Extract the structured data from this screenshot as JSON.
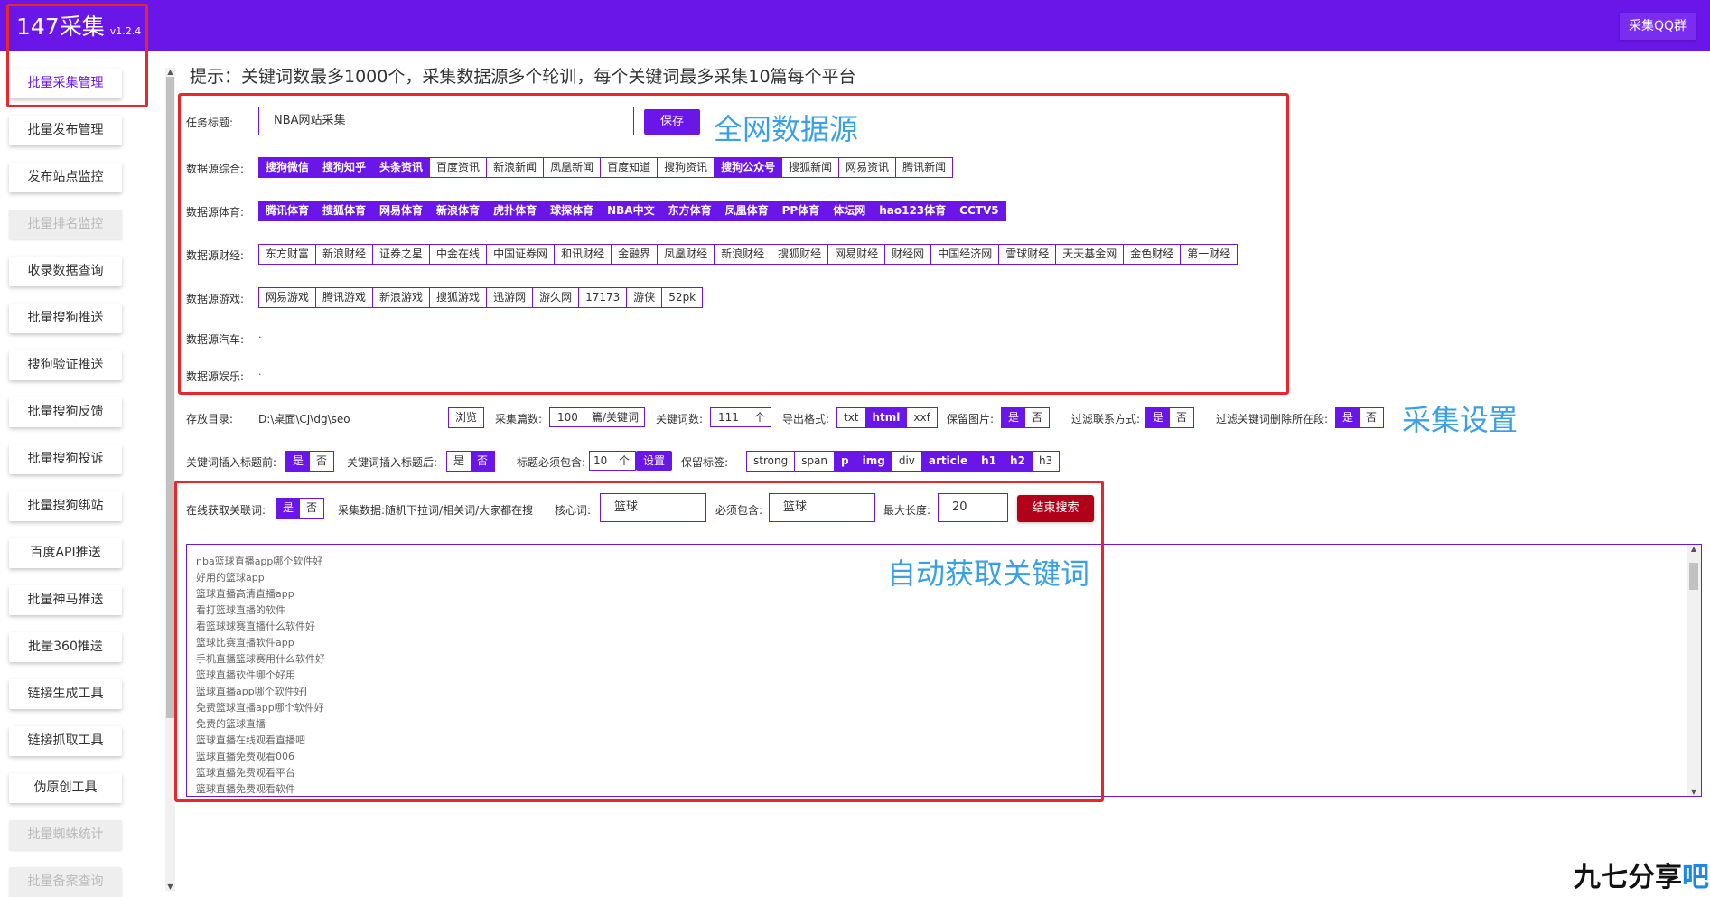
{
  "header": {
    "app_name": "147采集",
    "version": "v1.2.4",
    "qq_button": "采集QQ群"
  },
  "sidebar": {
    "items": [
      {
        "label": "批量采集管理",
        "state": "active"
      },
      {
        "label": "批量发布管理",
        "state": "normal"
      },
      {
        "label": "发布站点监控",
        "state": "normal"
      },
      {
        "label": "批量排名监控",
        "state": "disabled"
      },
      {
        "label": "收录数据查询",
        "state": "normal"
      },
      {
        "label": "批量搜狗推送",
        "state": "normal"
      },
      {
        "label": "搜狗验证推送",
        "state": "normal"
      },
      {
        "label": "批量搜狗反馈",
        "state": "normal"
      },
      {
        "label": "批量搜狗投诉",
        "state": "normal"
      },
      {
        "label": "批量搜狗绑站",
        "state": "normal"
      },
      {
        "label": "百度API推送",
        "state": "normal"
      },
      {
        "label": "批量神马推送",
        "state": "normal"
      },
      {
        "label": "批量360推送",
        "state": "normal"
      },
      {
        "label": "链接生成工具",
        "state": "normal"
      },
      {
        "label": "链接抓取工具",
        "state": "normal"
      },
      {
        "label": "伪原创工具",
        "state": "normal"
      },
      {
        "label": "批量蜘蛛统计",
        "state": "disabled"
      },
      {
        "label": "批量备案查询",
        "state": "disabled"
      }
    ]
  },
  "hint": "提示：关键词数最多1000个，采集数据源多个轮训，每个关键词最多采集10篇每个平台",
  "task": {
    "label": "任务标题:",
    "value": "NBA网站采集",
    "save_button": "保存"
  },
  "annotations": {
    "sources": "全网数据源",
    "settings": "采集设置",
    "keywords": "自动获取关键词"
  },
  "sources": {
    "general": {
      "label": "数据源综合:",
      "items": [
        {
          "name": "搜狗微信",
          "on": true
        },
        {
          "name": "搜狗知乎",
          "on": true
        },
        {
          "name": "头条资讯",
          "on": true
        },
        {
          "name": "百度资讯",
          "on": false
        },
        {
          "name": "新浪新闻",
          "on": false
        },
        {
          "name": "凤凰新闻",
          "on": false
        },
        {
          "name": "百度知道",
          "on": false
        },
        {
          "name": "搜狗资讯",
          "on": false
        },
        {
          "name": "搜狗公众号",
          "on": true
        },
        {
          "name": "搜狐新闻",
          "on": false
        },
        {
          "name": "网易资讯",
          "on": false
        },
        {
          "name": "腾讯新闻",
          "on": false
        }
      ]
    },
    "sports": {
      "label": "数据源体育:",
      "items": [
        {
          "name": "腾讯体育",
          "on": true
        },
        {
          "name": "搜狐体育",
          "on": true
        },
        {
          "name": "网易体育",
          "on": true
        },
        {
          "name": "新浪体育",
          "on": true
        },
        {
          "name": "虎扑体育",
          "on": true
        },
        {
          "name": "球探体育",
          "on": true
        },
        {
          "name": "NBA中文",
          "on": true
        },
        {
          "name": "东方体育",
          "on": true
        },
        {
          "name": "凤凰体育",
          "on": true
        },
        {
          "name": "PP体育",
          "on": true
        },
        {
          "name": "体坛网",
          "on": true
        },
        {
          "name": "hao123体育",
          "on": true
        },
        {
          "name": "CCTV5",
          "on": true
        }
      ]
    },
    "finance": {
      "label": "数据源财经:",
      "items": [
        {
          "name": "东方财富",
          "on": false
        },
        {
          "name": "新浪财经",
          "on": false
        },
        {
          "name": "证券之星",
          "on": false
        },
        {
          "name": "中金在线",
          "on": false
        },
        {
          "name": "中国证券网",
          "on": false
        },
        {
          "name": "和讯财经",
          "on": false
        },
        {
          "name": "金融界",
          "on": false
        },
        {
          "name": "凤凰财经",
          "on": false
        },
        {
          "name": "新浪财经",
          "on": false
        },
        {
          "name": "搜狐财经",
          "on": false
        },
        {
          "name": "网易财经",
          "on": false
        },
        {
          "name": "财经网",
          "on": false
        },
        {
          "name": "中国经济网",
          "on": false
        },
        {
          "name": "雪球财经",
          "on": false
        },
        {
          "name": "天天基金网",
          "on": false
        },
        {
          "name": "金色财经",
          "on": false
        },
        {
          "name": "第一财经",
          "on": false
        }
      ]
    },
    "games": {
      "label": "数据源游戏:",
      "items": [
        {
          "name": "网易游戏",
          "on": false
        },
        {
          "name": "腾讯游戏",
          "on": false
        },
        {
          "name": "新浪游戏",
          "on": false
        },
        {
          "name": "搜狐游戏",
          "on": false
        },
        {
          "name": "迅游网",
          "on": false
        },
        {
          "name": "游久网",
          "on": false
        },
        {
          "name": "17173",
          "on": false
        },
        {
          "name": "游侠",
          "on": false
        },
        {
          "name": "52pk",
          "on": false
        }
      ]
    },
    "auto": {
      "label": "数据源汽车:",
      "value": "."
    },
    "entertainment": {
      "label": "数据源娱乐:",
      "value": "."
    }
  },
  "settings": {
    "save_dir_label": "存放目录:",
    "save_dir": "D:\\桌面\\CJ\\dg\\seo",
    "browse_button": "浏览",
    "count_label": "采集篇数:",
    "count_value": "100",
    "count_unit": "篇/关键词",
    "kwcount_label": "关键词数:",
    "kwcount_value": "111",
    "kwcount_unit": "个",
    "export_label": "导出格式:",
    "export_formats": [
      {
        "name": "txt",
        "on": false
      },
      {
        "name": "html",
        "on": true
      },
      {
        "name": "xxf",
        "on": false
      }
    ],
    "keep_image_label": "保留图片:",
    "filter_contact_label": "过滤联系方式:",
    "filter_kw_label": "过滤关键词删除所在段:",
    "yes": "是",
    "no": "否",
    "insert_before_label": "关键词插入标题前:",
    "insert_after_label": "关键词插入标题后:",
    "must_contain_label": "标题必须包含:",
    "must_contain_value": "10",
    "must_contain_unit": "个",
    "set_button": "设置",
    "keep_tags_label": "保留标签:",
    "tags": [
      {
        "name": "strong",
        "on": false
      },
      {
        "name": "span",
        "on": false
      },
      {
        "name": "p",
        "on": true
      },
      {
        "name": "img",
        "on": true
      },
      {
        "name": "div",
        "on": false
      },
      {
        "name": "article",
        "on": true
      },
      {
        "name": "h1",
        "on": true
      },
      {
        "name": "h2",
        "on": true
      },
      {
        "name": "h3",
        "on": false
      }
    ]
  },
  "keywords": {
    "online_label": "在线获取关联词:",
    "source_desc": "采集数据:随机下拉词/相关词/大家都在搜",
    "core_label": "核心词:",
    "core_value": "篮球",
    "must_label": "必须包含:",
    "must_value": "篮球",
    "maxlen_label": "最大长度:",
    "maxlen_value": "20",
    "stop_button": "结束搜索",
    "results": [
      "nba篮球直播app哪个软件好",
      "好用的篮球app",
      "篮球直播高清直播app",
      "看打篮球直播的软件",
      "看篮球球赛直播什么软件好",
      "篮球比赛直播软件app",
      "手机直播篮球赛用什么软件好",
      "篮球直播软件哪个好用",
      "篮球直播app哪个软件好J",
      "免费篮球直播app哪个软件好",
      "免费的篮球直播",
      "篮球直播在线观看直播吧",
      "篮球直播免费观看006",
      "篮球直播免费观看平台",
      "篮球直播免费观看软件"
    ]
  },
  "watermark": {
    "main": "九七分享",
    "accent": "吧"
  },
  "colors": {
    "accent": "#6a16e8",
    "annotation": "#3aa0e6",
    "stop_button": "#b3001a",
    "highlight_box": "#e8262b"
  }
}
